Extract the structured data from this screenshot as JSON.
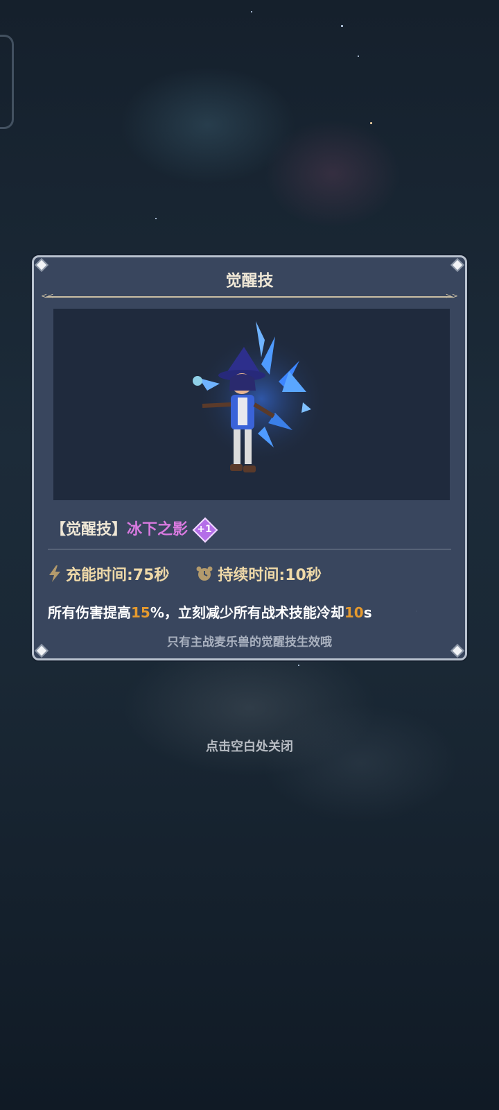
{
  "panel": {
    "title": "觉醒技",
    "skill_prefix": "【觉醒技】",
    "skill_name": "冰下之影",
    "level_badge": "+1",
    "charge_time": "充能时间:75秒",
    "duration": "持续时间:10秒",
    "desc": {
      "part1": "所有伤害提高",
      "value1": "15",
      "part2": "%，立刻减少所有战术技能冷却",
      "value2": "10",
      "part3": "s"
    },
    "note": "只有主战麦乐兽的觉醒技生效哦"
  },
  "close_hint": "点击空白处关闭",
  "icons": {
    "charge": "lightning-icon",
    "duration": "alarm-clock-icon",
    "badge": "diamond-badge-icon"
  },
  "colors": {
    "skill_name": "#d97ae0",
    "highlight": "#e69a2e",
    "stat_text": "#efd9a8"
  }
}
